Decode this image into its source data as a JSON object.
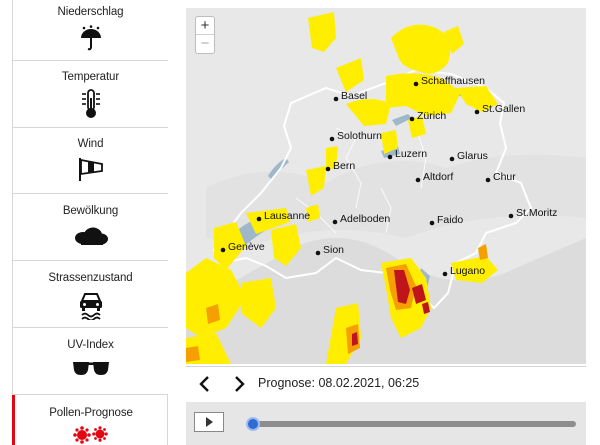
{
  "sidebar": {
    "items": [
      {
        "label": "Niederschlag",
        "icon": "umbrella-rain-icon"
      },
      {
        "label": "Temperatur",
        "icon": "thermometer-icon"
      },
      {
        "label": "Wind",
        "icon": "windsock-icon"
      },
      {
        "label": "Bewölkung",
        "icon": "cloud-icon"
      },
      {
        "label": "Strassenzustand",
        "icon": "car-road-icon"
      },
      {
        "label": "UV-Index",
        "icon": "sunglasses-icon"
      },
      {
        "label": "Pollen-Prognose",
        "icon": "pollen-icon",
        "active": true
      }
    ]
  },
  "map": {
    "zoom_in": "+",
    "zoom_out": "−",
    "cities": [
      "Basel",
      "Schaffhausen",
      "Zürich",
      "St.Gallen",
      "Solothurn",
      "Bern",
      "Luzern",
      "Glarus",
      "Altdorf",
      "Chur",
      "Lausanne",
      "Adelboden",
      "Faido",
      "St.Moritz",
      "Genève",
      "Sion",
      "Lugano"
    ]
  },
  "controls": {
    "forecast_label": "Prognose: 08.02.2021, 06:25",
    "slider_position": 0.0
  },
  "colors": {
    "accent": "#e30613",
    "pollen_low": "#ffee00",
    "pollen_mid": "#f5a000",
    "pollen_high": "#c0141c",
    "slider": "#2f6bd3"
  }
}
